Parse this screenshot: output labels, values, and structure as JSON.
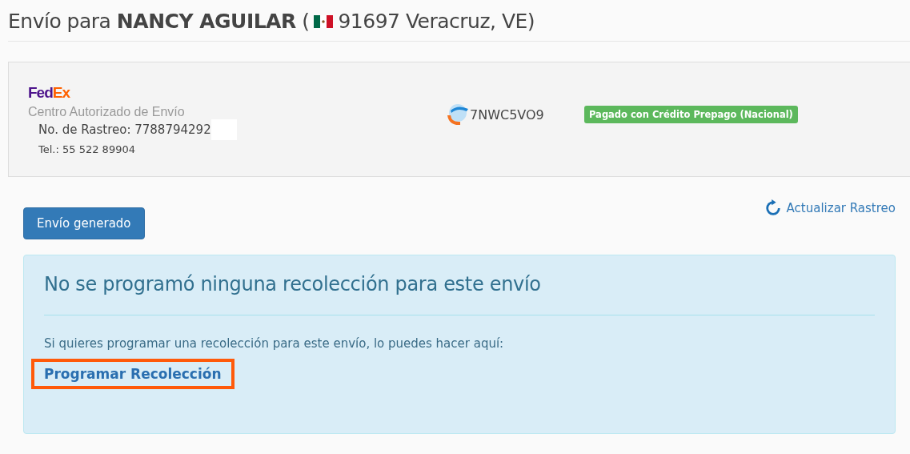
{
  "header": {
    "prefix": "Envío para",
    "name": "NANCY AGUILAR",
    "open_paren": "(",
    "location": "91697 Veracruz, VE)"
  },
  "carrier": {
    "logo_part_1": "Fed",
    "logo_part_2": "Ex",
    "subtitle": "Centro Autorizado de Envío",
    "tracking": "No. de Rastreo: 7788794292",
    "phone": "Tel.: 55 522 89904"
  },
  "guide": {
    "code": "7NWC5VO9",
    "badge": "Pagado con Crédito Prepago (Nacional)"
  },
  "status_button": "Envío generado",
  "refresh_link": "Actualizar Rastreo",
  "alert": {
    "heading": "No se programó ninguna recolección para este envío",
    "text": "Si quieres programar una recolección para este envío, lo puedes hacer aquí:",
    "link": "Programar Recolección",
    "highlighted": true
  }
}
